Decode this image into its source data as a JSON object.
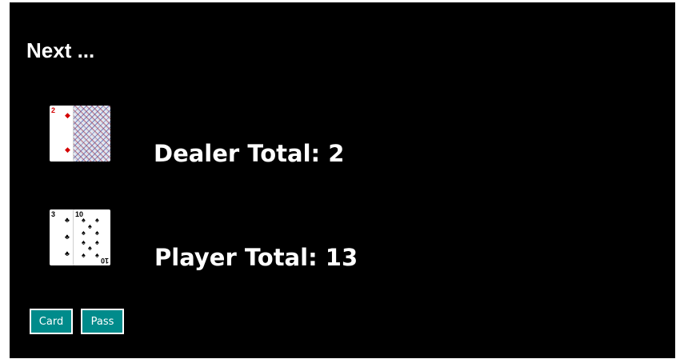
{
  "heading": "Next ...",
  "colors": {
    "background": "#000000",
    "text": "#ffffff",
    "button": "#008b8b",
    "red_suit": "#d40000"
  },
  "dealer": {
    "total_label": "Dealer Total: 2",
    "cards": [
      {
        "rank": "2",
        "suit": "diamonds",
        "face_up": true
      },
      {
        "face_up": false
      }
    ]
  },
  "player": {
    "total_label": "Player Total: 13",
    "cards": [
      {
        "rank": "3",
        "suit": "clubs",
        "face_up": true
      },
      {
        "rank": "10",
        "suit": "spades",
        "face_up": true
      }
    ]
  },
  "buttons": {
    "card_label": "Card",
    "pass_label": "Pass"
  }
}
